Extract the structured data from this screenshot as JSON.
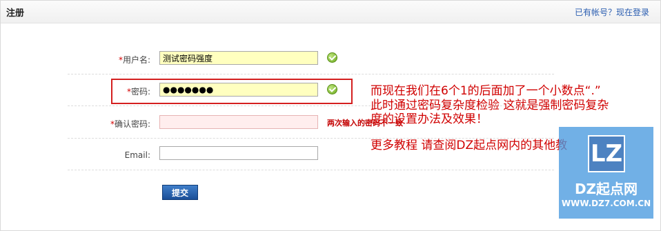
{
  "header": {
    "title": "注册",
    "login_link": "已有帐号？现在登录"
  },
  "form": {
    "username": {
      "required": "*",
      "label": "用户名:",
      "value": "测试密码强度",
      "status_icon": "check-icon"
    },
    "password": {
      "required": "*",
      "label": "密码:",
      "value": "●●●●●●●",
      "status_icon": "check-icon"
    },
    "confirm_password": {
      "required": "*",
      "label": "确认密码:",
      "value": "",
      "error": "两次输入的密码不一致"
    },
    "email": {
      "label": "Email:",
      "value": ""
    },
    "submit_label": "提交"
  },
  "annotation": {
    "line1": "而现在我们在6个1的后面加了一个小数点“.”",
    "line2": "此时通过密码复杂度检验   这就是强制密码复杂",
    "line3": "度的设置办法及效果！",
    "line4": "更多教程 请查阅DZ起点网内的其他教"
  },
  "watermark": {
    "logo_letters": "LZ",
    "site_name": "DZ起点网",
    "url": "WWW.DZ7.COM.CN"
  },
  "colors": {
    "annotation_red": "#d00000",
    "valid_input_bg": "#ffffbf",
    "invalid_input_bg": "#ffeeee",
    "submit_blue": "#1b4f98"
  }
}
